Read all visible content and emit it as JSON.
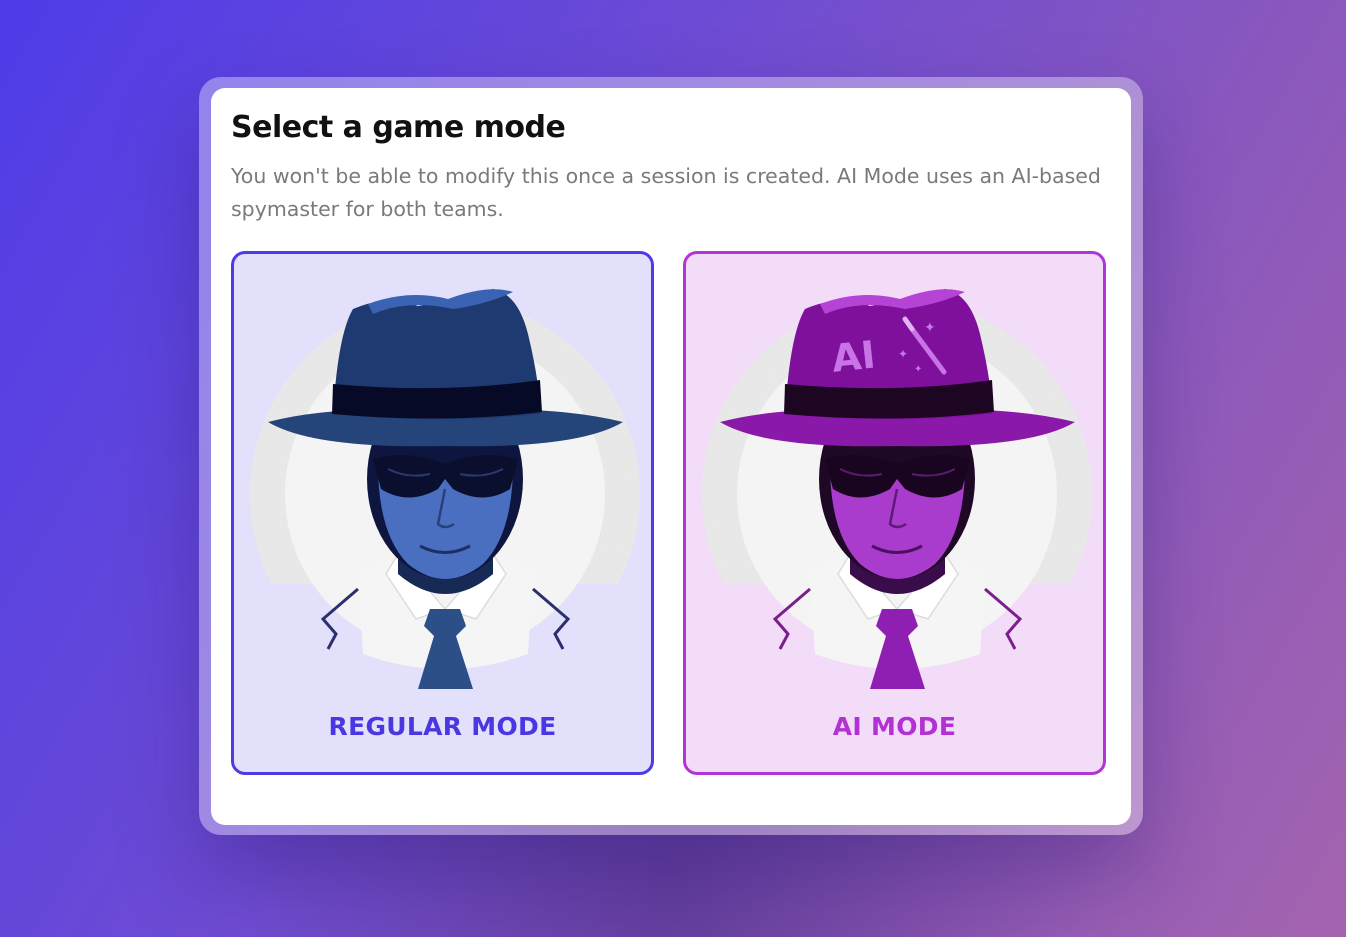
{
  "dialog": {
    "title": "Select a game mode",
    "description": "You won't be able to modify this once a session is created. AI Mode uses an AI-based spymaster for both teams."
  },
  "modes": [
    {
      "label": "REGULAR MODE",
      "icon": "spy-illustration-icon",
      "accent": "#4e3be6",
      "background": "#e2e0fb"
    },
    {
      "label": "AI MODE",
      "icon": "ai-spy-illustration-icon",
      "accent": "#b035d6",
      "background": "#f2dcf7",
      "hat_text": "AI"
    }
  ]
}
